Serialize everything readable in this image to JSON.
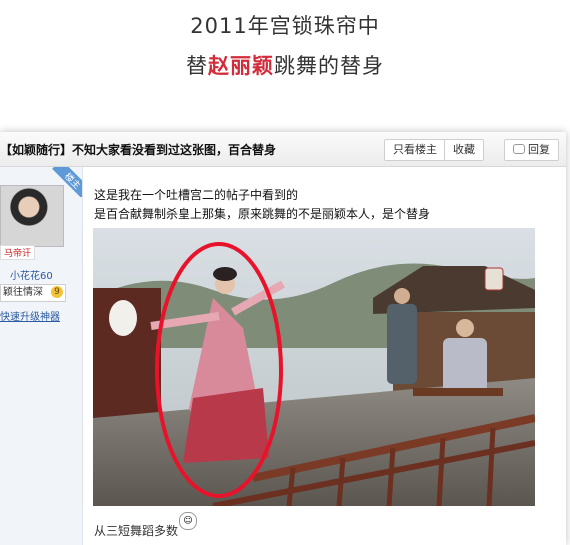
{
  "headline": {
    "line1": "2011年宫锁珠帘中",
    "line2_prefix": "替",
    "line2_highlight": "赵丽颖",
    "line2_suffix": "跳舞的替身"
  },
  "post": {
    "title": "【如颖随行】不知大家看没看到过这张图，百合替身",
    "buttons": [
      "只看楼主",
      "收藏",
      "回复"
    ],
    "corner_badge": "楼主",
    "body_lines": [
      "这是我在一个吐槽宫二的帖子中看到的",
      "是百合献舞制杀皇上那集，原来跳舞的不是丽颖本人，是个替身"
    ],
    "bottom_partial": "从三短舞蹈多数"
  },
  "author": {
    "avatar_tag": "马帝讦",
    "username": "小花花60",
    "rank_label": "颖往情深",
    "rank_level": "9",
    "upgrade_link": "快速升级神器"
  },
  "colors": {
    "highlight": "#d22b3a",
    "link": "#2a5aa0",
    "circle": "#e8132a"
  },
  "icons": [
    "reply-icon",
    "smiley-icon"
  ]
}
